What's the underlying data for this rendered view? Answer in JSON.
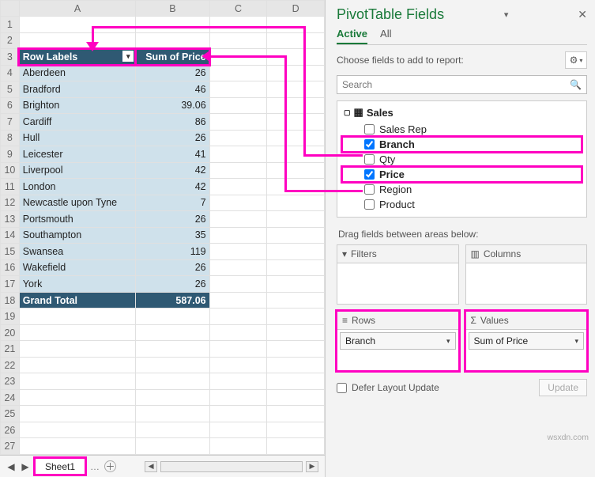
{
  "sheet": {
    "columns": [
      "A",
      "B",
      "C",
      "D"
    ],
    "pivot_header_a": "Row Labels",
    "pivot_header_b": "Sum of Price",
    "rows": [
      {
        "n": "1",
        "a": "",
        "b": ""
      },
      {
        "n": "2",
        "a": "",
        "b": ""
      },
      {
        "n": "3",
        "a": "Row Labels",
        "b": "Sum of Price",
        "is_header": true
      },
      {
        "n": "4",
        "a": "Aberdeen",
        "b": "26"
      },
      {
        "n": "5",
        "a": "Bradford",
        "b": "46"
      },
      {
        "n": "6",
        "a": "Brighton",
        "b": "39.06"
      },
      {
        "n": "7",
        "a": "Cardiff",
        "b": "86"
      },
      {
        "n": "8",
        "a": "Hull",
        "b": "26"
      },
      {
        "n": "9",
        "a": "Leicester",
        "b": "41"
      },
      {
        "n": "10",
        "a": "Liverpool",
        "b": "42"
      },
      {
        "n": "11",
        "a": "London",
        "b": "42"
      },
      {
        "n": "12",
        "a": "Newcastle upon Tyne",
        "b": "7"
      },
      {
        "n": "13",
        "a": "Portsmouth",
        "b": "26"
      },
      {
        "n": "14",
        "a": "Southampton",
        "b": "35"
      },
      {
        "n": "15",
        "a": "Swansea",
        "b": "119"
      },
      {
        "n": "16",
        "a": "Wakefield",
        "b": "26"
      },
      {
        "n": "17",
        "a": "York",
        "b": "26"
      },
      {
        "n": "18",
        "a": "Grand Total",
        "b": "587.06",
        "is_total": true
      }
    ],
    "empty_after": [
      "19",
      "20",
      "21",
      "22",
      "23",
      "24",
      "25",
      "26",
      "27"
    ],
    "tab_name": "Sheet1"
  },
  "pane": {
    "title": "PivotTable Fields",
    "tabs": {
      "active": "Active",
      "all": "All"
    },
    "choose_label": "Choose fields to add to report:",
    "search_placeholder": "Search",
    "tree_root": "Sales",
    "fields": [
      {
        "name": "Sales Rep",
        "checked": false,
        "highlight": false
      },
      {
        "name": "Branch",
        "checked": true,
        "highlight": true
      },
      {
        "name": "Qty",
        "checked": false,
        "highlight": false
      },
      {
        "name": "Price",
        "checked": true,
        "highlight": true
      },
      {
        "name": "Region",
        "checked": false,
        "highlight": false
      },
      {
        "name": "Product",
        "checked": false,
        "highlight": false
      }
    ],
    "drag_label": "Drag fields between areas below:",
    "areas": {
      "filters": {
        "label": "Filters",
        "items": []
      },
      "columns": {
        "label": "Columns",
        "items": []
      },
      "rows": {
        "label": "Rows",
        "items": [
          "Branch"
        ]
      },
      "values": {
        "label": "Values",
        "items": [
          "Sum of Price"
        ]
      }
    },
    "defer_label": "Defer Layout Update",
    "update_label": "Update"
  },
  "watermark": "wsxdn.com"
}
